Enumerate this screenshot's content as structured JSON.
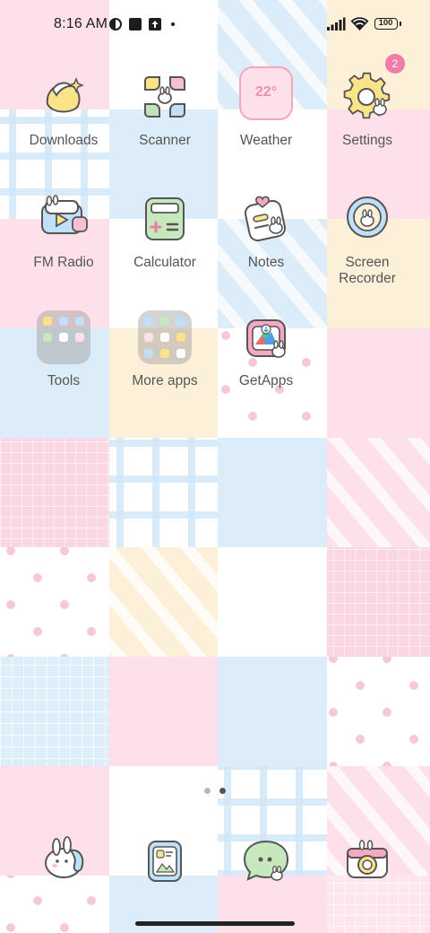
{
  "status_bar": {
    "time": "8:16 AM",
    "battery": "100",
    "icons": [
      "app-notification-icon",
      "square-notification-icon",
      "upload-notification-icon",
      "more-dot-icon",
      "signal-icon",
      "wifi-icon",
      "battery-icon"
    ]
  },
  "apps": {
    "downloads": {
      "label": "Downloads",
      "icon": "downloads-icon"
    },
    "scanner": {
      "label": "Scanner",
      "icon": "scanner-icon"
    },
    "weather": {
      "label": "Weather",
      "temp": "22°",
      "icon": "weather-icon"
    },
    "settings": {
      "label": "Settings",
      "badge": "2",
      "icon": "gear-icon"
    },
    "fm_radio": {
      "label": "FM Radio",
      "icon": "radio-icon"
    },
    "calculator": {
      "label": "Calculator",
      "icon": "calculator-icon"
    },
    "notes": {
      "label": "Notes",
      "icon": "notes-icon"
    },
    "screen_recorder": {
      "label": "Screen\nRecorder",
      "icon": "screen-recorder-icon"
    },
    "tools": {
      "label": "Tools",
      "icon": "folder-icon"
    },
    "more_apps": {
      "label": "More apps",
      "icon": "folder-icon"
    },
    "getapps": {
      "label": "GetApps",
      "icon": "getapps-icon"
    }
  },
  "page_indicator": {
    "pages": 2,
    "current": 2
  },
  "dock": [
    "phone-icon",
    "gallery-icon",
    "messages-icon",
    "camera-icon"
  ],
  "colors": {
    "pink": "#fde0ea",
    "blue": "#dcedf9",
    "yellow": "#fdf0d8",
    "white": "#ffffff",
    "badge": "#f07ca8",
    "label": "#555555"
  }
}
